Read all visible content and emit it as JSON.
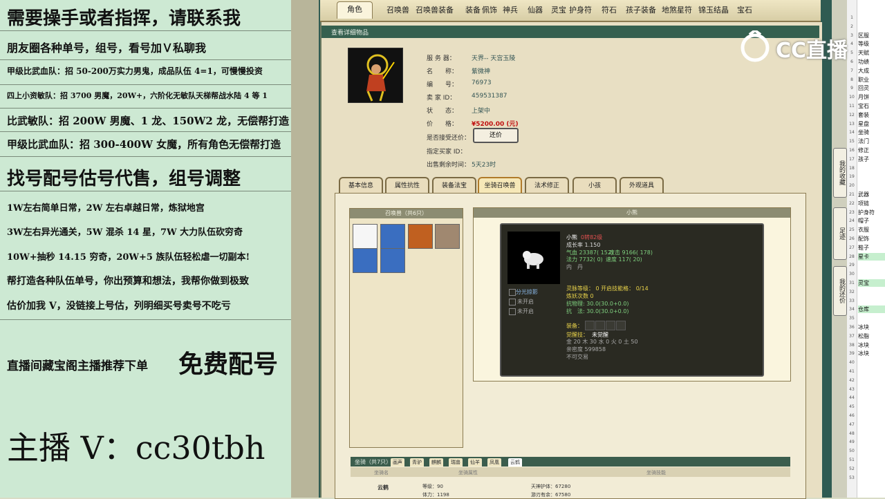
{
  "overlay": {
    "lines": [
      {
        "text": "需要操手或者指挥，请联系我",
        "size": 26
      },
      {
        "text": "朋友圈各种单号，组号，看号加Ｖ私聊我",
        "size": 16
      },
      {
        "text": "甲级比武血队：招 50-200万实力男鬼，成品队伍 4=1，可慢慢投资",
        "size": 12
      },
      {
        "text": "四上小资敏队：招 3700 男魔，20W+，六阶化无敏队天梯帮战水陆 4 等 1",
        "size": 11
      },
      {
        "text": "比武敏队：招 200W 男魔、1 龙、150W2 龙，无偿帮打造",
        "size": 15
      },
      {
        "text": "甲级比武血队：招 300-400W 女魔，所有角色无偿帮打造",
        "size": 15
      },
      {
        "text": "找号配号估号代售，组号调整",
        "size": 26
      },
      {
        "text": "1W左右简单日常，2W 左右卓越日常，炼狱地宫",
        "size": 13
      },
      {
        "text": "3W左右异光通关，5W 混杀 14 星，7W 大力队伍砍穷奇",
        "size": 13
      },
      {
        "text": "10W+抽秒 14.15 穷奇，20W+5 族队伍轻松虐一切副本!",
        "size": 13
      },
      {
        "text": "帮打造各种队伍单号，你出预算和想法，我帮你做到极致",
        "size": 14
      },
      {
        "text": "估价加我 V，没链接上号估，列明细买号卖号不吃亏",
        "size": 14
      }
    ],
    "recommend_prefix": "直播间藏宝阁主播推荐下单",
    "recommend_big": "免费配号",
    "streamer": "主播 V：cc30tbh"
  },
  "nav": {
    "tabs": [
      "角色",
      "召唤兽",
      "召唤兽装备",
      "装备",
      "佩饰",
      "神兵",
      "仙器",
      "灵宝",
      "护身符",
      "符石",
      "孩子装备",
      "地煞星符",
      "锦玉结晶",
      "宝石"
    ],
    "active": "角色"
  },
  "detail_bar": "查看详细物品",
  "character": {
    "server_label": "服 务 器：",
    "server": "天界-- 天宫玉陵",
    "name_label": "名　　称：",
    "name": "紫微神",
    "id_label": "编　　号：",
    "id": "76973",
    "seller_label": "卖 家 ID：",
    "seller": "459531387",
    "status_label": "状　　态：",
    "status": "上架中",
    "price_label": "价　　格：",
    "price": "¥5200.00 (元)",
    "bargain_label": "是否接受还价：",
    "bargain_btn": "还价",
    "buyer_label": "指定买家 ID：",
    "time_label": "出售剩余时间：",
    "time": "5天23时"
  },
  "subtabs": [
    "基本信息",
    "属性抗性",
    "装备法宝",
    "坐骑召唤兽",
    "法术修正",
    "小孩",
    "外观道具"
  ],
  "subtab_active": "坐骑召唤兽",
  "pet_panel_title": "召唤兽（共6只）",
  "detail_panel_title": "小熊",
  "pet": {
    "name": "小熊",
    "level": "0转82级",
    "growth": "成长率 1.150",
    "hp": "气血 23387( 152)",
    "atk": "攻击 9166( 178)",
    "mp": "法力 7732( 0)",
    "spd": "速度 117( 20)",
    "neidan": "内　丹",
    "skill1": "分光掠影",
    "skill2": "未开启",
    "skill3": "未开启",
    "spirit": "灵脉等级： 0 开启技能格： 0/14",
    "refine": "炼妖次数 0",
    "resist_phys": "抗物理: 30.0(30.0+0.0)",
    "resist_mag": "抗　法: 30.0(30.0+0.0)",
    "equip_label": "装备：",
    "awaken_label": "觉醒技：",
    "awaken": "未觉醒",
    "elements": "金 20 木 30 水 0 火 0 土 50",
    "intimacy": "亲密度 599858",
    "untradeable": "不可交易"
  },
  "mount": {
    "title": "坐骑（共7只）",
    "tabs": [
      "画声",
      "青驴",
      "麒麟",
      "瑞兽",
      "仙羊",
      "凤凰",
      "云鹤"
    ],
    "active": "云鹤",
    "headers": [
      "坐骑名",
      "坐骑属性",
      "坐骑技能"
    ],
    "name": "云鹤",
    "level": "等级：90",
    "stamina": "体力：1198",
    "skill1": "天神护体：67280",
    "skill2": "游刃有余：67580"
  },
  "side_buttons": [
    "我的收藏",
    "足迹",
    "我的还价"
  ],
  "logo_text": "CC直播",
  "sheet": {
    "rows": [
      {
        "n": "1",
        "c": ""
      },
      {
        "n": "2",
        "c": ""
      },
      {
        "n": "3",
        "c": "区服"
      },
      {
        "n": "4",
        "c": "等级"
      },
      {
        "n": "5",
        "c": "天赋"
      },
      {
        "n": "6",
        "c": "功绩"
      },
      {
        "n": "7",
        "c": "大成"
      },
      {
        "n": "8",
        "c": "职业"
      },
      {
        "n": "9",
        "c": "回灵"
      },
      {
        "n": "10",
        "c": "月饼"
      },
      {
        "n": "11",
        "c": "宝石"
      },
      {
        "n": "12",
        "c": "套装"
      },
      {
        "n": "13",
        "c": "星盘"
      },
      {
        "n": "14",
        "c": "坐骑"
      },
      {
        "n": "15",
        "c": "法门"
      },
      {
        "n": "16",
        "c": "修正"
      },
      {
        "n": "17",
        "c": "孩子"
      },
      {
        "n": "18",
        "c": ""
      },
      {
        "n": "19",
        "c": ""
      },
      {
        "n": "20",
        "c": ""
      },
      {
        "n": "21",
        "c": "武器"
      },
      {
        "n": "22",
        "c": "项链"
      },
      {
        "n": "23",
        "c": "护身符"
      },
      {
        "n": "24",
        "c": "帽子"
      },
      {
        "n": "25",
        "c": "衣服"
      },
      {
        "n": "26",
        "c": "配饰"
      },
      {
        "n": "27",
        "c": "鞋子"
      },
      {
        "n": "28",
        "c": "星卡"
      },
      {
        "n": "29",
        "c": ""
      },
      {
        "n": "30",
        "c": ""
      },
      {
        "n": "31",
        "c": "灵宝"
      },
      {
        "n": "32",
        "c": ""
      },
      {
        "n": "33",
        "c": ""
      },
      {
        "n": "34",
        "c": "仓库"
      },
      {
        "n": "35",
        "c": ""
      },
      {
        "n": "36",
        "c": "冰块"
      },
      {
        "n": "37",
        "c": "松脂"
      },
      {
        "n": "38",
        "c": "冰块"
      },
      {
        "n": "39",
        "c": "冰块"
      },
      {
        "n": "40",
        "c": ""
      },
      {
        "n": "41",
        "c": ""
      },
      {
        "n": "42",
        "c": ""
      },
      {
        "n": "43",
        "c": ""
      },
      {
        "n": "44",
        "c": ""
      },
      {
        "n": "45",
        "c": ""
      },
      {
        "n": "46",
        "c": ""
      },
      {
        "n": "47",
        "c": ""
      },
      {
        "n": "48",
        "c": ""
      },
      {
        "n": "49",
        "c": ""
      },
      {
        "n": "50",
        "c": ""
      },
      {
        "n": "51",
        "c": ""
      },
      {
        "n": "52",
        "c": ""
      },
      {
        "n": "53",
        "c": ""
      }
    ],
    "green_rows": [
      "28",
      "31",
      "34"
    ]
  }
}
